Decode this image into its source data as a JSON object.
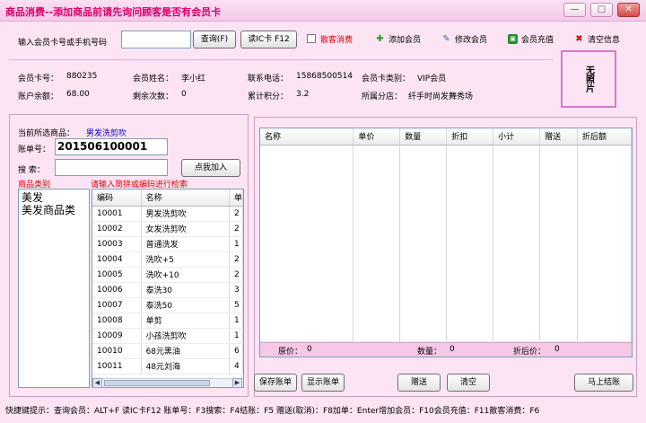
{
  "window": {
    "title": "商品消费--添加商品前请先询问顾客是否有会员卡",
    "min": "—",
    "max": "□",
    "close": "✕"
  },
  "search": {
    "label": "输入会员卡号或手机号码",
    "value": "",
    "query_button": "查询(F)",
    "ic_button": "读IC卡 F12",
    "walkin_label": "散客消费"
  },
  "toolbar": {
    "add_member": "添加会员",
    "edit_member": "修改会员",
    "recharge": "会员充值",
    "clear": "清空信息"
  },
  "member": {
    "card_no_label": "会员卡号：",
    "card_no": "880235",
    "name_label": "会员姓名：",
    "name": "李小红",
    "phone_label": "联系电话：",
    "phone": "15868500514",
    "type_label": "会员卡类别：",
    "type": "VIP会员",
    "balance_label": "账户余额：",
    "balance": "68.00",
    "remaining_label": "剩余次数：",
    "remaining": "0",
    "points_label": "累计积分：",
    "points": "3.2",
    "store_label": "所属分店：",
    "store": "纤手时尚发舞秀场",
    "photo": "无照片"
  },
  "left": {
    "selected_label": "当前所选商品：",
    "selected_value": "男发洗剪吹",
    "bill_label": "账单号：",
    "bill_no": "201506100001",
    "search_label": "搜  索：",
    "add_button": "点我加入",
    "category_title": "商品类别",
    "hint": "请输入简拼或编码进行检索",
    "categories": [
      "美发",
      "美发商品类"
    ]
  },
  "product_table": {
    "headers": [
      "编码",
      "名称",
      "单"
    ],
    "rows": [
      [
        "10001",
        "男发洗剪吹",
        "2"
      ],
      [
        "10002",
        "女发洗剪吹",
        "2"
      ],
      [
        "10003",
        "普通洗发",
        "1"
      ],
      [
        "10004",
        "洗吹+5",
        "2"
      ],
      [
        "10005",
        "洗吹+10",
        "2"
      ],
      [
        "10006",
        "泰洗30",
        "3"
      ],
      [
        "10007",
        "泰洗50",
        "5"
      ],
      [
        "10008",
        "单剪",
        "1"
      ],
      [
        "10009",
        "小孩洗剪吹",
        "1"
      ],
      [
        "10010",
        "68元黑油",
        "6"
      ],
      [
        "10011",
        "48元刘海",
        "4"
      ]
    ]
  },
  "order_table": {
    "headers": [
      "名称",
      "单价",
      "数量",
      "折扣",
      "小计",
      "赠送",
      "折后额"
    ],
    "footer": {
      "orig_label": "原价：",
      "orig": "0",
      "qty_label": "数量：",
      "qty": "0",
      "after_label": "折后价：",
      "after": "0"
    }
  },
  "actions": {
    "save": "保存账单",
    "show": "显示账单",
    "gift": "赠送",
    "clear": "清空",
    "checkout": "马上结账"
  },
  "status": "快捷键提示：查询会员：ALT+F 读IC卡F12 账单号：F3搜索：F4结账：F5 赠送(取消)：F8加单：Enter增加会员：F10会员充值：F11散客消费：F6",
  "colors": {
    "title": "#d8006a",
    "accent_blue": "#0000cc",
    "red": "#e00000"
  }
}
